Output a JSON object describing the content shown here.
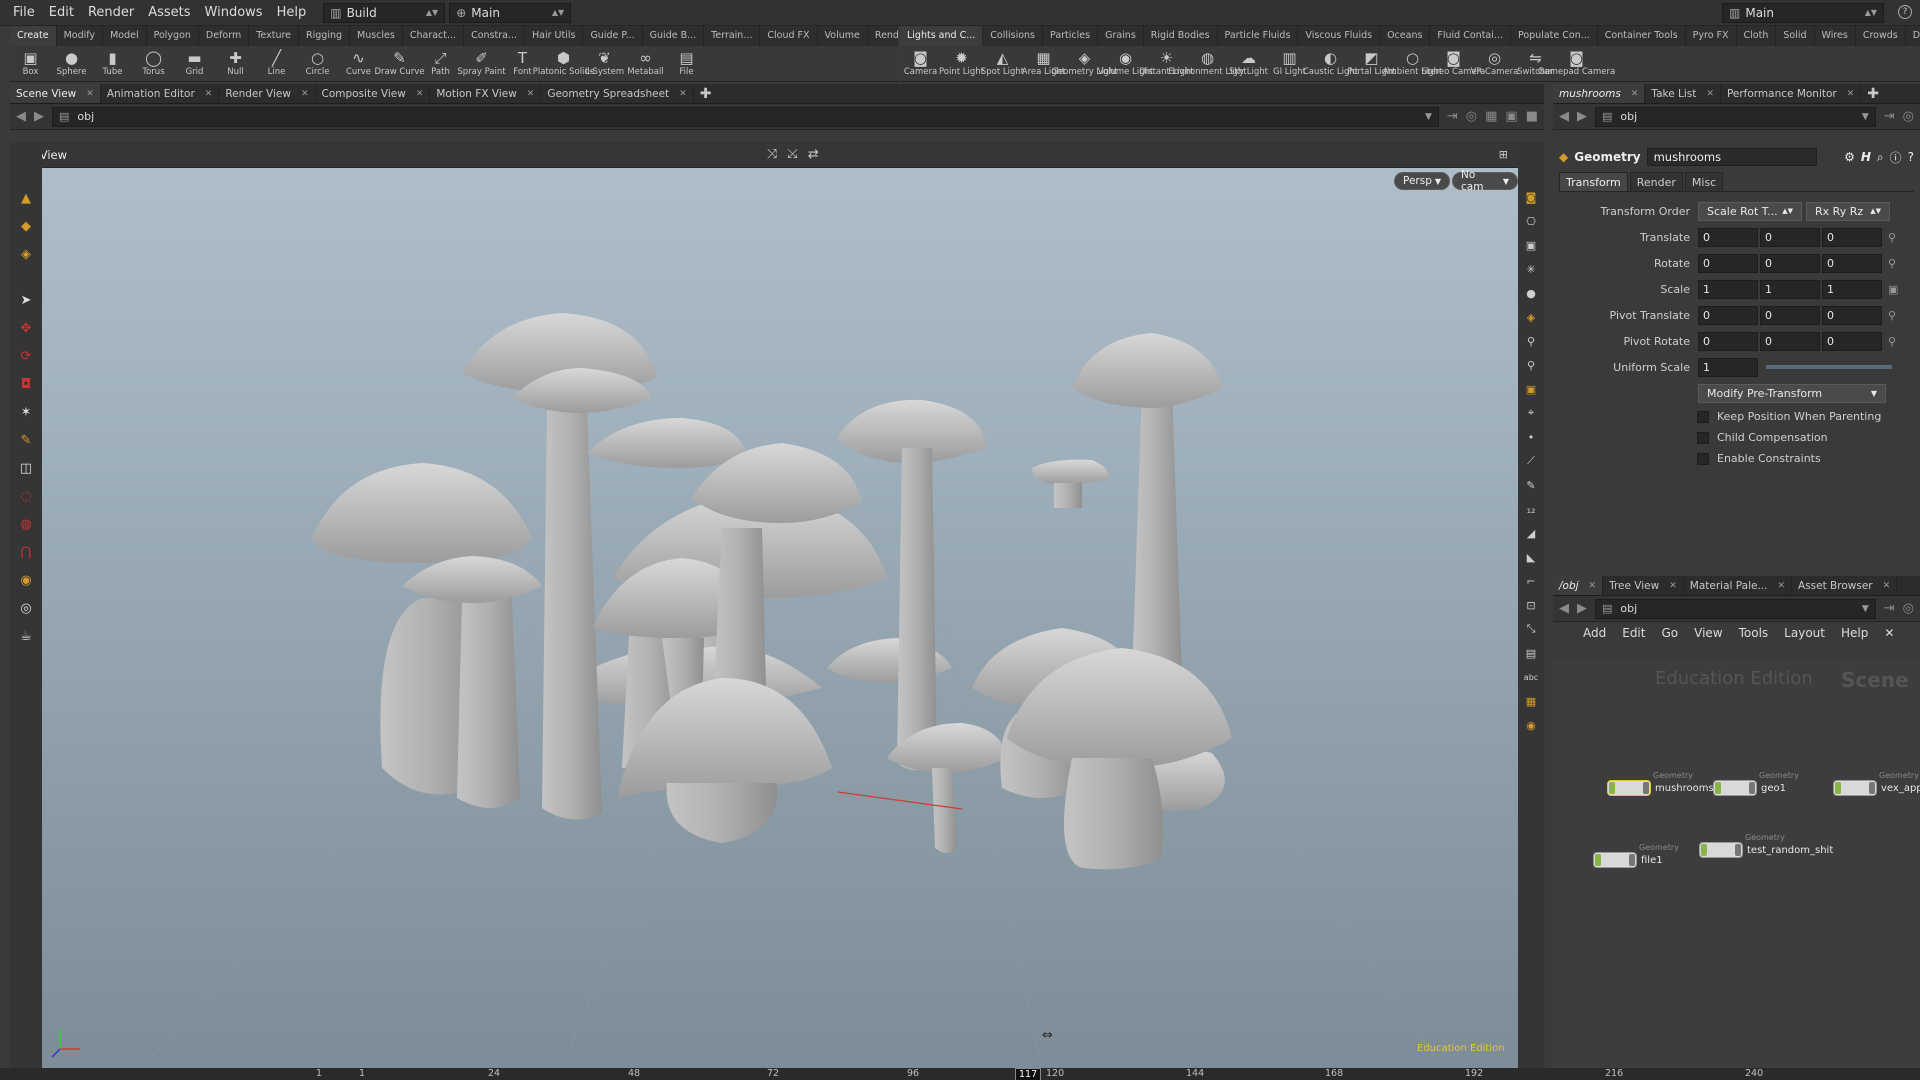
{
  "menubar": {
    "items": [
      "File",
      "Edit",
      "Render",
      "Assets",
      "Windows",
      "Help"
    ],
    "desktop": "Build",
    "context": "Main",
    "right_desktop": "Main"
  },
  "shelf_left": {
    "tabs": [
      "Create",
      "Modify",
      "Model",
      "Polygon",
      "Deform",
      "Texture",
      "Rigging",
      "Muscles",
      "Charact...",
      "Constra...",
      "Hair Utils",
      "Guide P...",
      "Guide B...",
      "Terrain...",
      "Cloud FX",
      "Volume",
      "Render..."
    ],
    "tools": [
      {
        "label": "Box",
        "icon": "box-icon",
        "glyph": "▣"
      },
      {
        "label": "Sphere",
        "icon": "sphere-icon",
        "glyph": "●"
      },
      {
        "label": "Tube",
        "icon": "tube-icon",
        "glyph": "▮"
      },
      {
        "label": "Torus",
        "icon": "torus-icon",
        "glyph": "◯"
      },
      {
        "label": "Grid",
        "icon": "grid-icon",
        "glyph": "▬"
      },
      {
        "label": "Null",
        "icon": "null-icon",
        "glyph": "✚"
      },
      {
        "label": "Line",
        "icon": "line-icon",
        "glyph": "╱"
      },
      {
        "label": "Circle",
        "icon": "circle-icon",
        "glyph": "○"
      },
      {
        "label": "Curve",
        "icon": "curve-icon",
        "glyph": "∿"
      },
      {
        "label": "Draw Curve",
        "icon": "draw-curve-icon",
        "glyph": "✎"
      },
      {
        "label": "Path",
        "icon": "path-icon",
        "glyph": "⤢"
      },
      {
        "label": "Spray Paint",
        "icon": "spray-paint-icon",
        "glyph": "✐"
      },
      {
        "label": "Font",
        "icon": "font-icon",
        "glyph": "T"
      },
      {
        "label": "Platonic Solids",
        "icon": "platonic-solids-icon",
        "glyph": "⬢"
      },
      {
        "label": "L-System",
        "icon": "l-system-icon",
        "glyph": "❦"
      },
      {
        "label": "Metaball",
        "icon": "metaball-icon",
        "glyph": "∞"
      },
      {
        "label": "File",
        "icon": "file-icon",
        "glyph": "▤"
      }
    ]
  },
  "shelf_right": {
    "tabs": [
      "Lights and C...",
      "Collisions",
      "Particles",
      "Grains",
      "Rigid Bodies",
      "Particle Fluids",
      "Viscous Fluids",
      "Oceans",
      "Fluid Contai...",
      "Populate Con...",
      "Container Tools",
      "Pyro FX",
      "Cloth",
      "Solid",
      "Wires",
      "Crowds",
      "Drive Simula..."
    ],
    "tools": [
      {
        "label": "Camera",
        "icon": "camera-icon",
        "glyph": "◙"
      },
      {
        "label": "Point Light",
        "icon": "point-light-icon",
        "glyph": "✹"
      },
      {
        "label": "Spot Light",
        "icon": "spot-light-icon",
        "glyph": "◭"
      },
      {
        "label": "Area Light",
        "icon": "area-light-icon",
        "glyph": "▦"
      },
      {
        "label": "Geometry Light",
        "icon": "geometry-light-icon",
        "glyph": "◈"
      },
      {
        "label": "Volume Light",
        "icon": "volume-light-icon",
        "glyph": "◉"
      },
      {
        "label": "Distant Light",
        "icon": "distant-light-icon",
        "glyph": "☀"
      },
      {
        "label": "Environment Light",
        "icon": "environment-light-icon",
        "glyph": "◍"
      },
      {
        "label": "Sky Light",
        "icon": "sky-light-icon",
        "glyph": "☁"
      },
      {
        "label": "GI Light",
        "icon": "gi-light-icon",
        "glyph": "▥"
      },
      {
        "label": "Caustic Light",
        "icon": "caustic-light-icon",
        "glyph": "◐"
      },
      {
        "label": "Portal Light",
        "icon": "portal-light-icon",
        "glyph": "◩"
      },
      {
        "label": "Ambient Light",
        "icon": "ambient-light-icon",
        "glyph": "○"
      },
      {
        "label": "Stereo Camera",
        "icon": "stereo-camera-icon",
        "glyph": "◙"
      },
      {
        "label": "VR Camera",
        "icon": "vr-camera-icon",
        "glyph": "◎"
      },
      {
        "label": "Switcher",
        "icon": "switcher-icon",
        "glyph": "⇋"
      },
      {
        "label": "Gamepad Camera",
        "icon": "gamepad-camera-icon",
        "glyph": "◙"
      }
    ]
  },
  "scene_tabs": [
    "Scene View",
    "Animation Editor",
    "Render View",
    "Composite View",
    "Motion FX View",
    "Geometry Spreadsheet"
  ],
  "scene_path": "obj",
  "viewport": {
    "title": "View",
    "persp_button": "Persp",
    "cam_button": "No cam",
    "watermark": "Education Edition"
  },
  "timeline": {
    "start": "1",
    "current": "117",
    "end": "240",
    "ticks": [
      "1",
      "24",
      "48",
      "72",
      "96",
      "120",
      "144",
      "168",
      "192",
      "216"
    ]
  },
  "param_tabs": [
    "mushrooms",
    "Take List",
    "Performance Monitor"
  ],
  "param_path": "obj",
  "params": {
    "node_type": "Geometry",
    "node_name": "mushrooms",
    "tabs": [
      "Transform",
      "Render",
      "Misc"
    ],
    "transform_order": "Scale Rot T...",
    "rot_order": "Rx Ry Rz",
    "rows": [
      {
        "label": "Transform Order"
      },
      {
        "label": "Translate",
        "values": [
          "0",
          "0",
          "0"
        ]
      },
      {
        "label": "Rotate",
        "values": [
          "0",
          "0",
          "0"
        ]
      },
      {
        "label": "Scale",
        "values": [
          "1",
          "1",
          "1"
        ]
      },
      {
        "label": "Pivot Translate",
        "values": [
          "0",
          "0",
          "0"
        ]
      },
      {
        "label": "Pivot Rotate",
        "values": [
          "0",
          "0",
          "0"
        ]
      }
    ],
    "uniform_scale_label": "Uniform Scale",
    "uniform_scale": "1",
    "modify_pre": "Modify Pre-Transform",
    "checkboxes": [
      "Keep Position When Parenting",
      "Child Compensation",
      "Enable Constraints"
    ]
  },
  "net_tabs": [
    "/obj",
    "Tree View",
    "Material Pale...",
    "Asset Browser"
  ],
  "net_path": "obj",
  "net_menu": [
    "Add",
    "Edit",
    "Go",
    "View",
    "Tools",
    "Layout",
    "Help"
  ],
  "net_watermark": "Education Edition",
  "net_scene_label": "Scene",
  "nodes": [
    {
      "name": "mushrooms",
      "type": "Geometry"
    },
    {
      "name": "geo1",
      "type": "Geometry"
    },
    {
      "name": "vex_appr",
      "type": "Geometry"
    },
    {
      "name": "file1",
      "type": "Geometry"
    },
    {
      "name": "test_random_shit",
      "type": "Geometry"
    }
  ]
}
